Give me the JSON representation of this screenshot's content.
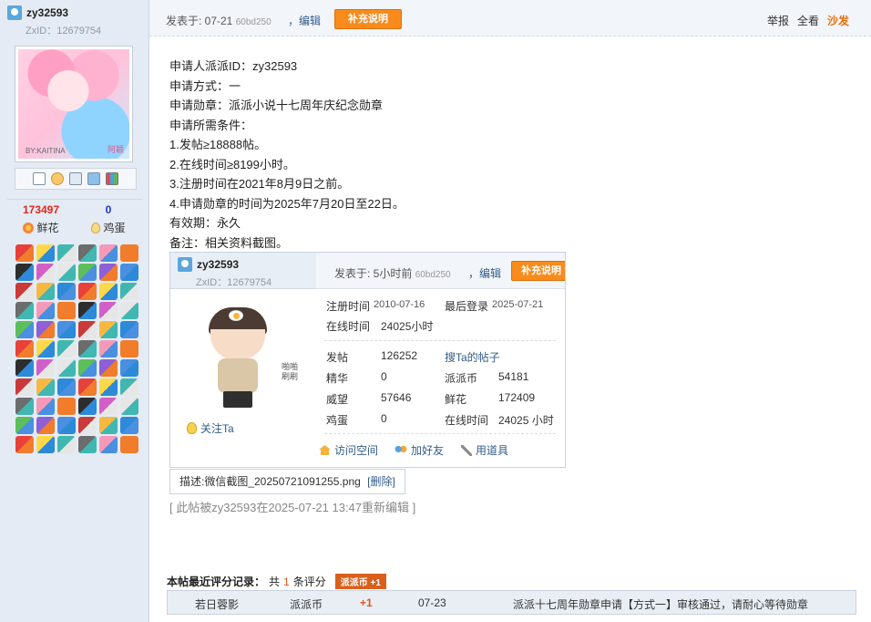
{
  "user": {
    "name": "zy32593",
    "zxid": "ZxID：12679754",
    "avatar_tag": "阿颖",
    "avatar_sig": "BY:KAITINA",
    "flowers_count": "173497",
    "flowers_label": "鲜花",
    "eggs_count": "0",
    "eggs_label": "鸡蛋"
  },
  "post_header": {
    "posted_label": "发表于: 07-21",
    "posted_extra": "60bd250",
    "edit_label": "，编辑",
    "supplement_button": "补充说明",
    "report": "举报",
    "view_all": "全看",
    "sofa": "沙发"
  },
  "content": {
    "lines": [
      "申请人派派ID：zy32593",
      "申请方式：一",
      "申请勋章：派派小说十七周年庆纪念勋章",
      "申请所需条件：",
      "1.发帖≥18888帖。",
      "2.在线时间≥8199小时。",
      "3.注册时间在2021年8月9日之前。",
      "4.申请勋章的时间为2025年7月20日至22日。",
      "有效期：永久",
      "备注：相关资料截图。"
    ]
  },
  "card": {
    "name": "zy32593",
    "zxid": "ZxID：12679754",
    "posted_label": "发表于: 5小时前",
    "posted_extra": "60bd250",
    "edit_label": "，编辑",
    "supplement_button": "补充说明",
    "follow_label": "关注Ta",
    "doll_note": "啪啪\n刷刷",
    "register_label": "注册时间",
    "register_value": "2010-07-16",
    "last_login_label": "最后登录",
    "last_login_value": "2025-07-21",
    "online_label": "在线时间",
    "online_value": "24025小时",
    "posts_label": "发帖",
    "posts_value": "126252",
    "search_posts_link": "搜Ta的帖子",
    "essence_label": "精华",
    "essence_value": "0",
    "coins_label": "派派币",
    "coins_value": "54181",
    "prestige_label": "威望",
    "prestige_value": "57646",
    "flowers_label": "鲜花",
    "flowers_value": "172409",
    "eggs_label": "鸡蛋",
    "eggs_value": "0",
    "online2_label": "在线时间",
    "online2_value": "24025 小时",
    "visit_space": "访问空间",
    "add_friend": "加好友",
    "use_tool": "用道具"
  },
  "attachment_desc": "描述:微信截图_20250721091255.png",
  "attachment_delete": "[删除]",
  "edit_note": "[ 此帖被zy32593在2025-07-21 13:47重新编辑 ]",
  "rating": {
    "title_prefix": "本帖最近评分记录：",
    "title_mid1": "共",
    "count": "1",
    "title_mid2": "条评分",
    "badge": "派派币 +1",
    "rater": "若日蓉影",
    "currency": "派派币",
    "amount": "+1",
    "date": "07-23",
    "reason": "派派十七周年勋章申请【方式一】审核通过，请耐心等待勋章"
  },
  "colors": {
    "accent_orange": "#f98b1c",
    "link_blue": "#335c8a",
    "flower_count": "#e8261c",
    "egg_count": "#1a36c8"
  }
}
